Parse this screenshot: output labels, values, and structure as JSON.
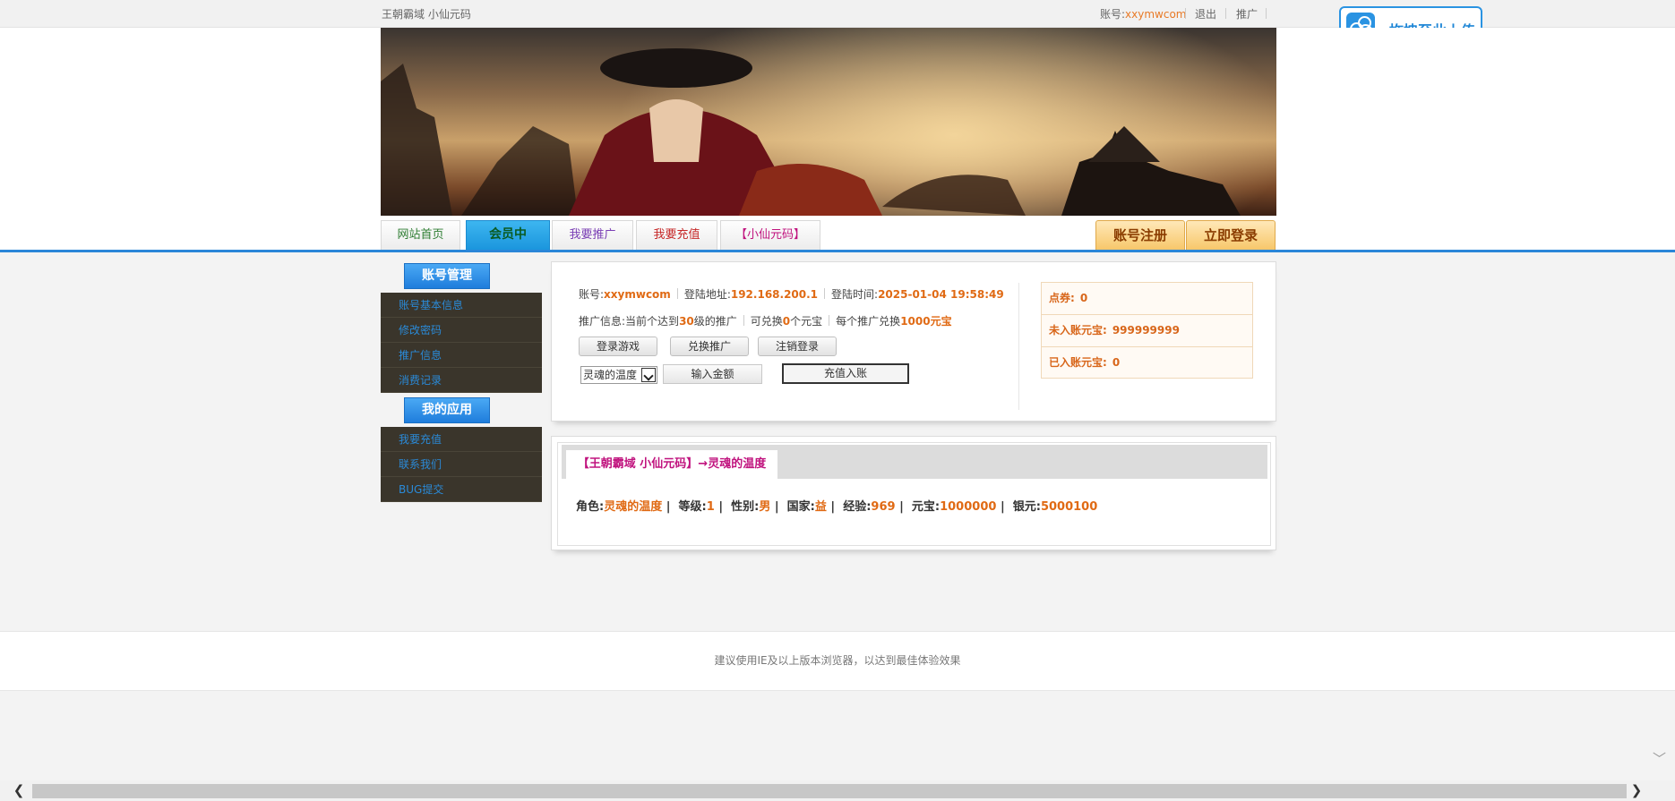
{
  "topbar": {
    "site_name": "王朝霸域 小仙元码",
    "account_label": "账号:",
    "account_value": "xxymwcom",
    "logout": "退出",
    "promote": "推广"
  },
  "upload_widget": {
    "label": "拖拽至此上传",
    "icon": "baidu-cloud-icon"
  },
  "nav": {
    "tabs": [
      {
        "label": "网站首页",
        "color": "#2e7d32"
      },
      {
        "label": "会员中",
        "color": "#0a5a20"
      },
      {
        "label": "我要推广",
        "color": "#7b3fb5"
      },
      {
        "label": "我要充值",
        "color": "#c62828"
      },
      {
        "label": "【小仙元码】",
        "color": "#c0137e"
      }
    ],
    "register": "账号注册",
    "login": "立即登录"
  },
  "sidebar": {
    "account_header": "账号管理",
    "account_items": [
      "账号基本信息",
      "修改密码",
      "推广信息",
      "消费记录"
    ],
    "apps_header": "我的应用",
    "app_items": [
      "我要充值",
      "联系我们",
      "BUG提交"
    ]
  },
  "account_panel": {
    "account_label": "账号:",
    "account_value": "xxymwcom",
    "login_addr_label": "登陆地址:",
    "login_addr_value": "192.168.200.1",
    "login_time_label": "登陆时间:",
    "login_time_value": "2025-01-04 19:58:49",
    "promo_label": "推广信息:",
    "promo_text_1": "当前个达到",
    "promo_level": "30",
    "promo_text_2": "级的推广",
    "exch_text_1": "可兑换",
    "exch_count": "0",
    "exch_text_2": "个元宝",
    "each_text_1": "每个推广兑换",
    "each_amount": "1000元宝",
    "buttons": [
      "登录游戏",
      "兑换推广",
      "注销登录"
    ],
    "role_select": "灵魂的温度",
    "amount_placeholder": "输入金额",
    "charge_button": "充值入账"
  },
  "balance": {
    "points_label": "点券:",
    "points_value": "0",
    "pending_label": "未入账元宝:",
    "pending_value": "999999999",
    "credited_label": "已入账元宝:",
    "credited_value": "0"
  },
  "character": {
    "tab_title": "【王朝霸域 小仙元码】→灵魂的温度",
    "role_label": "角色:",
    "role_value": "灵魂的温度",
    "level_label": "等级:",
    "level_value": "1",
    "gender_label": "性别:",
    "gender_value": "男",
    "nation_label": "国家:",
    "nation_value": "益",
    "exp_label": "经验:",
    "exp_value": "969",
    "yuanbao_label": "元宝:",
    "yuanbao_value": "1000000",
    "silver_label": "银元:",
    "silver_value": "5000100"
  },
  "footer": {
    "text": "建议使用IE及以上版本浏览器，以达到最佳体验效果"
  },
  "scrollbar": {
    "left_arrow": "❮",
    "right_arrow": "❯",
    "down_arrow": "﹀"
  }
}
